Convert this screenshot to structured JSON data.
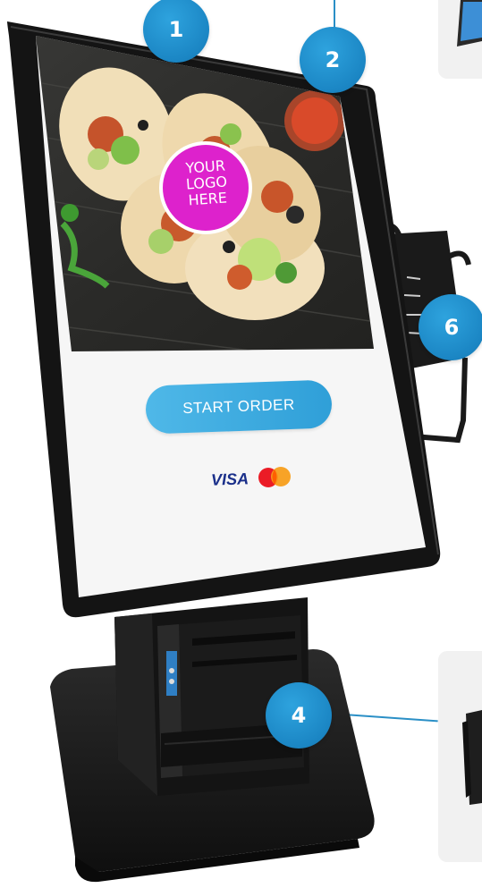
{
  "markers": {
    "m1": "1",
    "m2": "2",
    "m4": "4",
    "m6": "6"
  },
  "screen": {
    "logo_placeholder": "YOUR\nLOGO\nHERE",
    "start_button": "START ORDER",
    "visa": "VISA"
  },
  "colors": {
    "marker": "#1b86c4",
    "start_button": "#3aa9df",
    "logo_circle": "#dd22cc",
    "kiosk_body": "#151515"
  }
}
